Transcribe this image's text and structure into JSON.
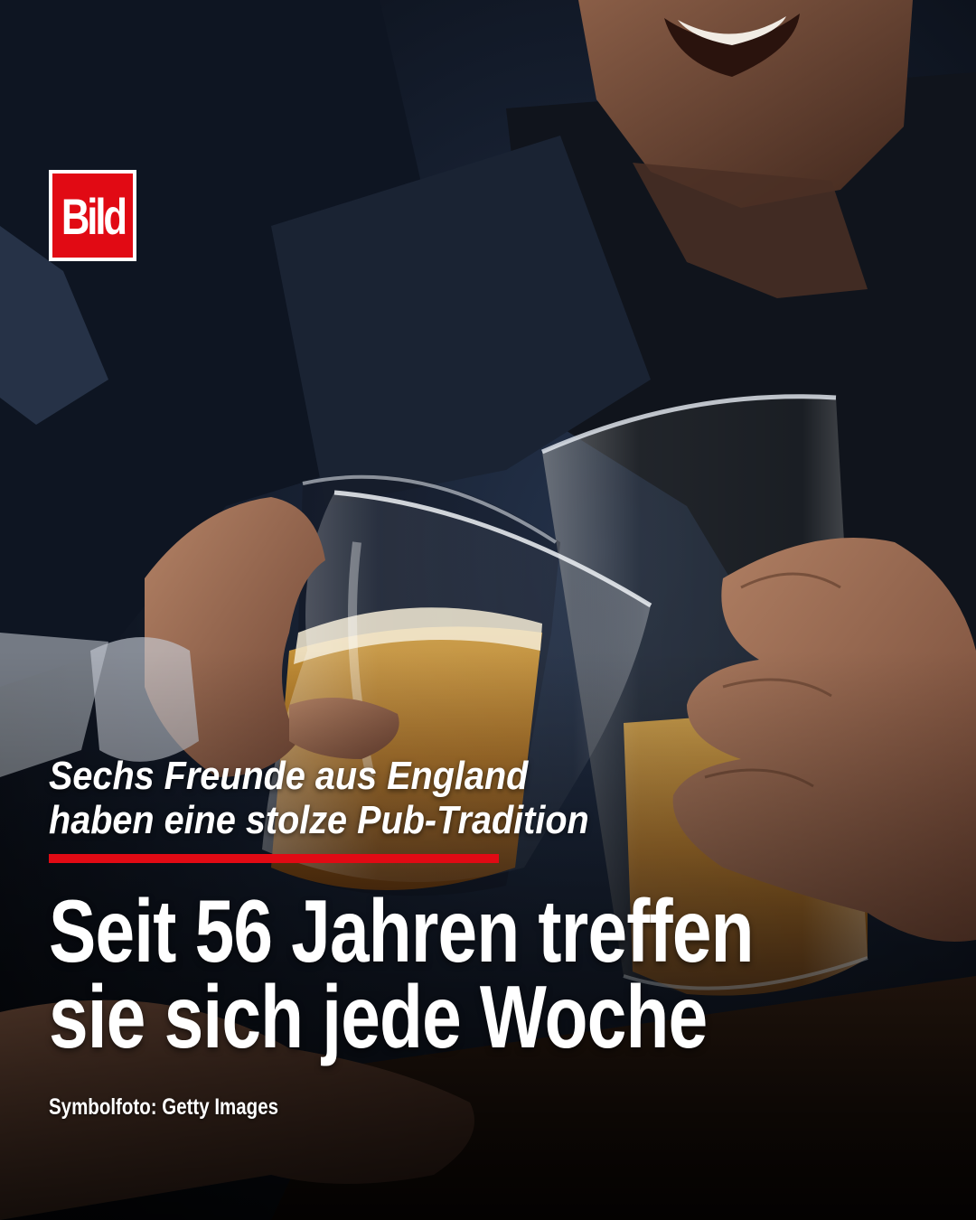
{
  "brand": {
    "logo_text": "Bild",
    "logo_color": "#e10a14"
  },
  "kicker": {
    "line1": "Sechs Freunde aus England",
    "line2": "haben eine stolze Pub-Tradition"
  },
  "headline": {
    "line1": "Seit 56 Jahren treffen",
    "line2": "sie sich jede Woche"
  },
  "credit": "Symbolfoto: Getty Images",
  "colors": {
    "accent": "#e10a14",
    "text": "#ffffff",
    "background": "#0b0f17"
  }
}
